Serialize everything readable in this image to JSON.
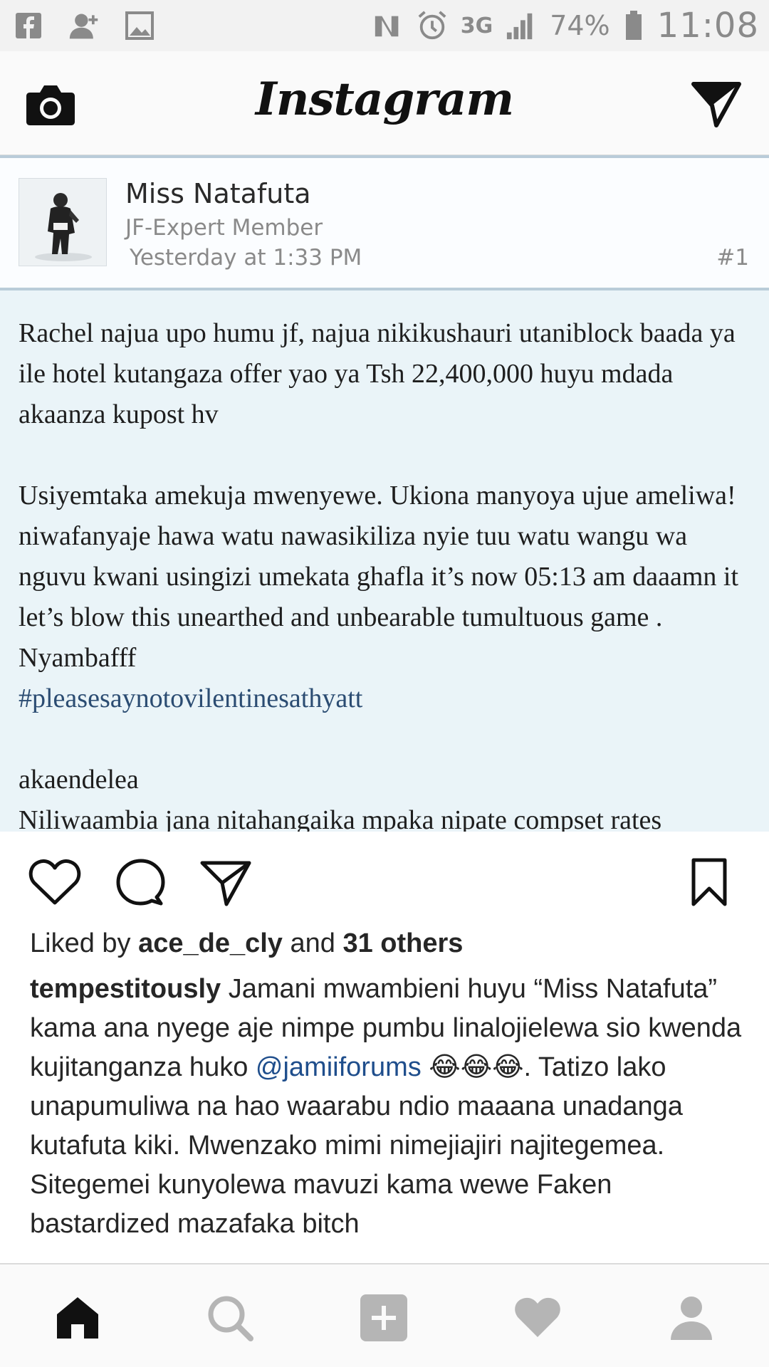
{
  "status_bar": {
    "battery": "74%",
    "network": "3G",
    "time": "11:08",
    "left_icons": [
      "facebook-icon",
      "add-contact-icon",
      "gallery-icon"
    ],
    "right_icons": [
      "nfc-icon",
      "alarm-icon",
      "signal-icon",
      "battery-icon"
    ]
  },
  "app": {
    "logo": "Instagram",
    "camera_icon": "camera-icon",
    "direct_icon": "direct-send-icon"
  },
  "post_image": {
    "username": "Miss Natafuta",
    "rank": "JF-Expert Member",
    "date": "Yesterday at 1:33 PM",
    "post_number": "#1",
    "paragraph_1": "Rachel najua upo humu jf, najua nikikushauri utaniblock baada ya ile hotel kutangaza offer yao ya Tsh 22,400,000 huyu mdada akaanza kupost hv",
    "paragraph_2": "Usiyemtaka amekuja mwenyewe. Ukiona manyoya ujue ameliwa! niwafanyaje hawa watu nawasikiliza nyie tuu watu wangu wa nguvu kwani usingizi umekata ghafla it’s now 05:13 am daaamn it let’s blow this unearthed and unbearable tumultuous game . Nyambafff",
    "hashtag": "#pleasesaynotovilentinesathyatt",
    "paragraph_3": "akaendelea",
    "paragraph_4": "Niliwaambia jana nitahangaika mpaka nipate compset rates"
  },
  "actions": {
    "like_icon": "heart-icon",
    "comment_icon": "comment-icon",
    "share_icon": "share-icon",
    "save_icon": "bookmark-icon"
  },
  "likes": {
    "prefix": "Liked by ",
    "user": "ace_de_cly",
    "middle": " and ",
    "others": "31 others"
  },
  "caption": {
    "username": "tempestitously",
    "text_1": " Jamani mwambieni huyu “Miss Natafuta” kama ana nyege aje nimpe pumbu linalojielewa sio kwenda kujitanganza huko ",
    "mention": "@jamiiforums",
    "emoji": " 😂😂😂",
    "text_2": ". Tatizo lako unapumuliwa na hao waarabu ndio maaana unadanga kutafuta kiki. Mwenzako mimi nimejiajiri najitegemea. Sitegemei kunyolewa mavuzi kama wewe Faken bastardized mazafaka bitch"
  },
  "bottom_nav": {
    "items": [
      "home-icon",
      "search-icon",
      "add-post-icon",
      "activity-icon",
      "profile-icon"
    ],
    "active": "home-icon"
  },
  "colors": {
    "post_background": "#eaf4f8",
    "hashtag": "#2b4c72",
    "mention": "#1f4e8c",
    "status_bar": "#f2f2f2"
  }
}
